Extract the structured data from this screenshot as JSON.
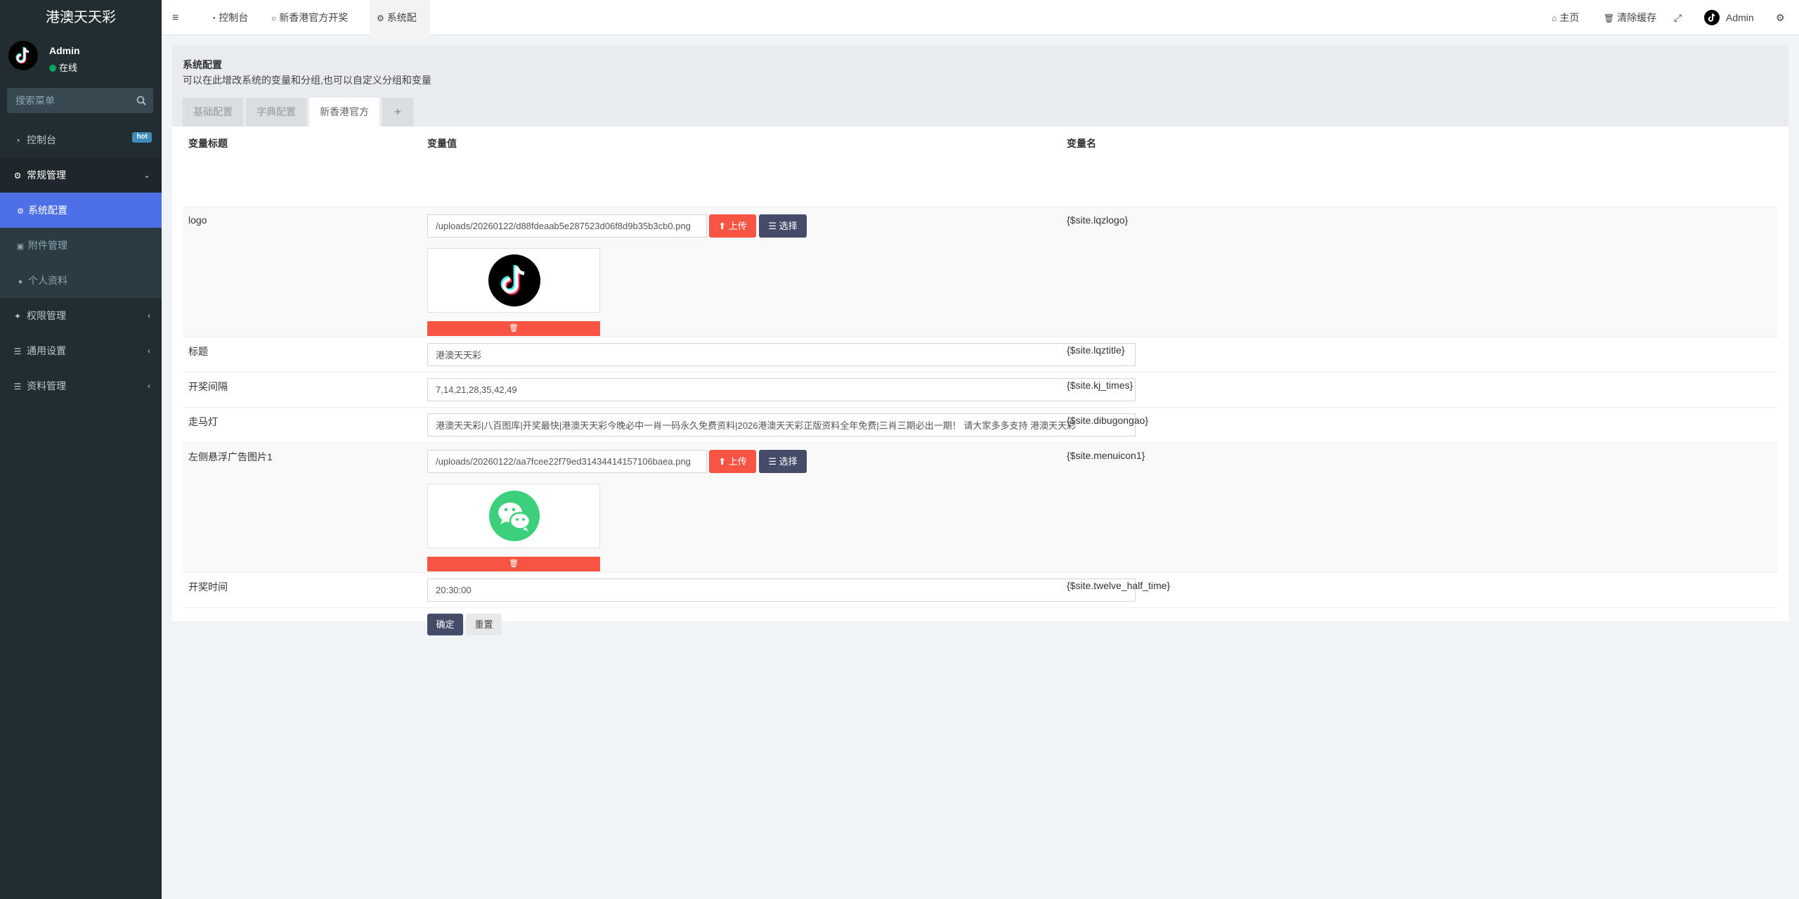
{
  "sidebar": {
    "brand": "港澳天天彩",
    "user": {
      "name": "Admin",
      "status": "在线"
    },
    "search_placeholder": "搜索菜单",
    "menu": {
      "dashboard": {
        "label": "控制台",
        "badge": "hot"
      },
      "general": {
        "label": "常规管理"
      },
      "sub": {
        "config": "系统配置",
        "attachment": "附件管理",
        "profile": "个人资料"
      },
      "auth": {
        "label": "权限管理"
      },
      "common": {
        "label": "通用设置"
      },
      "data": {
        "label": "资料管理"
      }
    }
  },
  "header": {
    "tabs": [
      "控制台",
      "新香港官方开奖",
      "系统配置"
    ],
    "home": "主页",
    "clear_cache": "清除缓存",
    "user": "Admin"
  },
  "panel": {
    "title": "系统配置",
    "description": "可以在此增改系统的变量和分组,也可以自定义分组和变量",
    "tabs": [
      "基础配置",
      "字典配置",
      "新香港官方",
      "+"
    ]
  },
  "table": {
    "headers": {
      "title": "变量标题",
      "value": "变量值",
      "name": "变量名"
    },
    "rows": {
      "logo": {
        "label": "logo",
        "value": "/uploads/20260122/d88fdeaab5e287523d06f8d9b35b3cb0.png",
        "var": "{$site.lqzlogo}"
      },
      "title": {
        "label": "标题",
        "value": "港澳天天彩",
        "var": "{$site.lqztitle}"
      },
      "interval": {
        "label": "开奖间隔",
        "value": "7,14,21,28,35,42,49",
        "var": "{$site.kj_times}"
      },
      "marquee": {
        "label": "走马灯",
        "value": "港澳天天彩|八百图库|开奖最快|港澳天天彩今晚必中一肖一码永久免费资料|2026港澳天天彩正版资料全年免费|三肖三期必出一期！ 请大家多多支持 港澳天天彩",
        "var": "{$site.dibugongao}"
      },
      "float_ad": {
        "label": "左侧悬浮广告图片1",
        "value": "/uploads/20260122/aa7fcee22f79ed31434414157106baea.png",
        "var": "{$site.menuicon1}"
      },
      "draw_time": {
        "label": "开奖时间",
        "value": "20:30:00",
        "var": "{$site.twelve_half_time}"
      }
    },
    "upload_label": "上传",
    "select_label": "选择"
  },
  "actions": {
    "ok": "确定",
    "reset": "重置"
  },
  "colors": {
    "sidebar": "#222d32",
    "active": "#4d70e6",
    "danger": "#f75444",
    "dark_button": "#444c69"
  }
}
